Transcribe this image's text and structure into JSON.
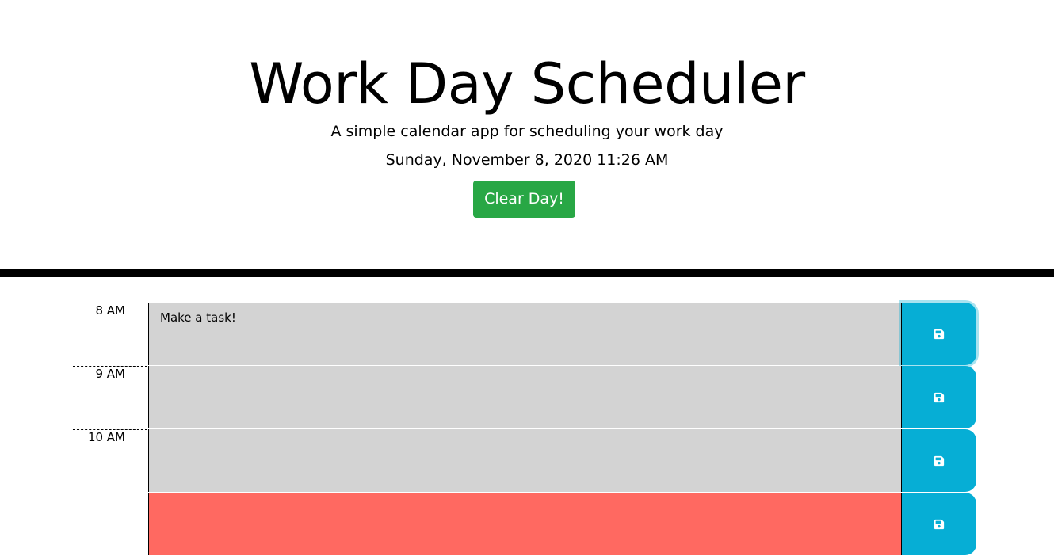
{
  "header": {
    "title": "Work Day Scheduler",
    "subtitle": "A simple calendar app for scheduling your work day",
    "current_day": "Sunday, November 8, 2020 11:26 AM",
    "clear_button_label": "Clear Day!"
  },
  "colors": {
    "past": "#d3d3d3",
    "present": "#ff6961",
    "save_button": "#06aed5",
    "clear_button": "#28a745"
  },
  "time_blocks": [
    {
      "hour": "8 AM",
      "task": "Make a task!",
      "state": "past",
      "save_icon": "save-icon"
    },
    {
      "hour": "9 AM",
      "task": "",
      "state": "past",
      "save_icon": "save-icon"
    },
    {
      "hour": "10 AM",
      "task": "",
      "state": "past",
      "save_icon": "save-icon"
    },
    {
      "hour": "",
      "task": "",
      "state": "present",
      "save_icon": "save-icon"
    }
  ]
}
